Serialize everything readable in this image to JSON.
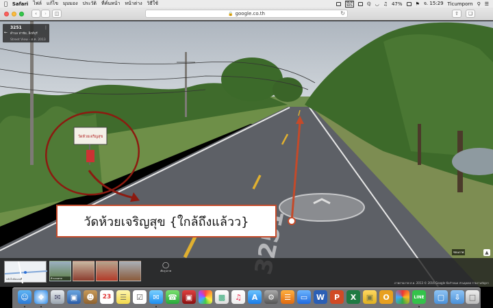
{
  "menubar": {
    "app": "Safari",
    "items": [
      "ไฟล์",
      "แก้ไข",
      "มุมมอง",
      "ประวัติ",
      "ที่คั่นหน้า",
      "หน้าต่าง",
      "วิธีใช้"
    ],
    "badge_top": "MEM",
    "badge_bottom": "98%",
    "battery": "47%",
    "clock": "จ. 15:29",
    "user": "Ticumporn"
  },
  "toolbar": {
    "url": "google.co.th"
  },
  "streetview": {
    "info": {
      "road": "3251",
      "place": "ตำบล ท่าชัย, สิงห์บุรี",
      "meta": "Street View - ส.ค. 2013"
    },
    "caption": "วัดห้วยเจริญสุข {ใกล้ถึงแล้วว}",
    "sign_text": "วัดห้วยเจริญสุข",
    "road_marking": "3251",
    "thumb_map_label": "กลับไปยังแผนที่",
    "thumb_labels": [
      "ห้ามจอดรถ",
      "",
      "",
      ""
    ],
    "photo_more": "เพิ่มรูปภาพ",
    "copyright": "ภาพถ่ายภาพ ส.ค. 2013 © 2016 Google  ข้อกำหนด  ส่วนบุคคล  รายงานปัญหา",
    "zoom_label": "ซ่อนภาพ"
  },
  "colors": {
    "annotation_red": "#b8321c",
    "sky": "#c8cfd6",
    "road": "#5d6066"
  },
  "dock": {
    "icons": [
      "finder-icon",
      "safari-icon",
      "mail-icon",
      "photos-preview-icon",
      "contacts-icon",
      "calendar-icon",
      "notes-icon",
      "reminders-icon",
      "messages-icon",
      "facetime-icon",
      "photo-booth-icon",
      "photos-icon",
      "charts-icon",
      "itunes-icon",
      "app-store-icon",
      "system-preferences-icon",
      "ibooks-icon",
      "keynote-icon",
      "word-icon",
      "powerpoint-icon",
      "excel-icon",
      "stickies-icon",
      "outlook-icon",
      "chrome-icon",
      "line-icon",
      "folder-icon",
      "downloads-icon",
      "trash-icon"
    ],
    "calendar_day": "23"
  }
}
